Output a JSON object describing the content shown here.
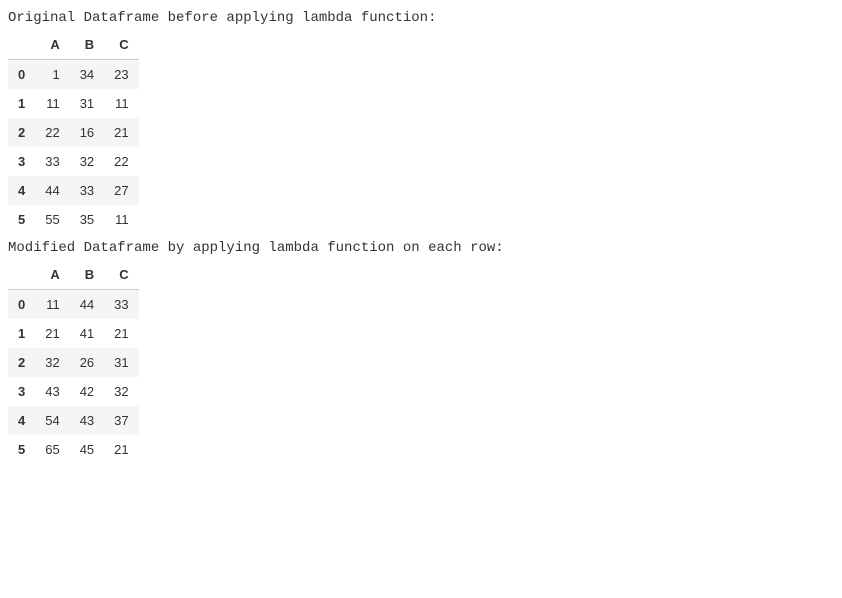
{
  "text": {
    "heading_original": "Original Dataframe before applying lambda function:",
    "heading_modified": "Modified Dataframe by applying lambda function on each row:"
  },
  "table_original": {
    "columns": [
      "A",
      "B",
      "C"
    ],
    "index": [
      "0",
      "1",
      "2",
      "3",
      "4",
      "5"
    ],
    "rows": [
      [
        "1",
        "34",
        "23"
      ],
      [
        "11",
        "31",
        "11"
      ],
      [
        "22",
        "16",
        "21"
      ],
      [
        "33",
        "32",
        "22"
      ],
      [
        "44",
        "33",
        "27"
      ],
      [
        "55",
        "35",
        "11"
      ]
    ]
  },
  "table_modified": {
    "columns": [
      "A",
      "B",
      "C"
    ],
    "index": [
      "0",
      "1",
      "2",
      "3",
      "4",
      "5"
    ],
    "rows": [
      [
        "11",
        "44",
        "33"
      ],
      [
        "21",
        "41",
        "21"
      ],
      [
        "32",
        "26",
        "31"
      ],
      [
        "43",
        "42",
        "32"
      ],
      [
        "54",
        "43",
        "37"
      ],
      [
        "65",
        "45",
        "21"
      ]
    ]
  }
}
